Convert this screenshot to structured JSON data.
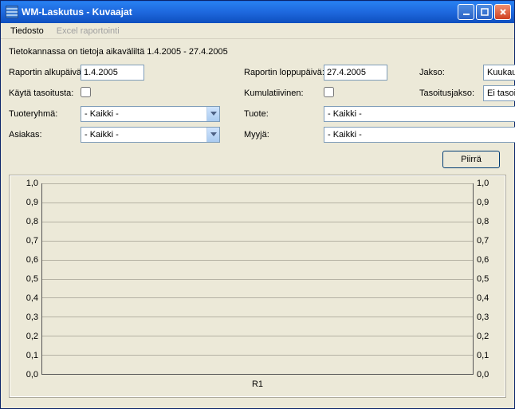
{
  "window": {
    "title": "WM-Laskutus - Kuvaajat"
  },
  "menu": {
    "file": "Tiedosto",
    "excel": "Excel raportointi"
  },
  "info": "Tietokannassa on tietoja aikaväliltä 1.4.2005 - 27.4.2005",
  "labels": {
    "start": "Raportin alkupäivä:",
    "end": "Raportin loppupäivä:",
    "period": "Jakso:",
    "smoothing": "Käytä tasoitusta:",
    "cumulative": "Kumulatiivinen:",
    "smoothing_period": "Tasoitusjakso:",
    "product_group": "Tuoteryhmä:",
    "product": "Tuote:",
    "customer": "Asiakas:",
    "seller": "Myyjä:"
  },
  "values": {
    "start_date": "1.4.2005",
    "end_date": "27.4.2005",
    "period": "Kuukausi",
    "smoothing_period": "Ei tasoitusta",
    "product_group": "- Kaikki -",
    "product": "- Kaikki -",
    "customer": "- Kaikki -",
    "seller": "- Kaikki -"
  },
  "buttons": {
    "draw": "Piirrä"
  },
  "chart_data": {
    "type": "line",
    "title": "",
    "xlabel": "R1",
    "ylabel": "",
    "ylim": [
      0.0,
      1.0
    ],
    "y_ticks": [
      "1,0",
      "0,9",
      "0,8",
      "0,7",
      "0,6",
      "0,5",
      "0,4",
      "0,3",
      "0,2",
      "0,1",
      "0,0"
    ],
    "y2_ticks": [
      "1,0",
      "0,9",
      "0,8",
      "0,7",
      "0,6",
      "0,5",
      "0,4",
      "0,3",
      "0,2",
      "0,1",
      "0,0"
    ],
    "categories": [],
    "series": []
  }
}
